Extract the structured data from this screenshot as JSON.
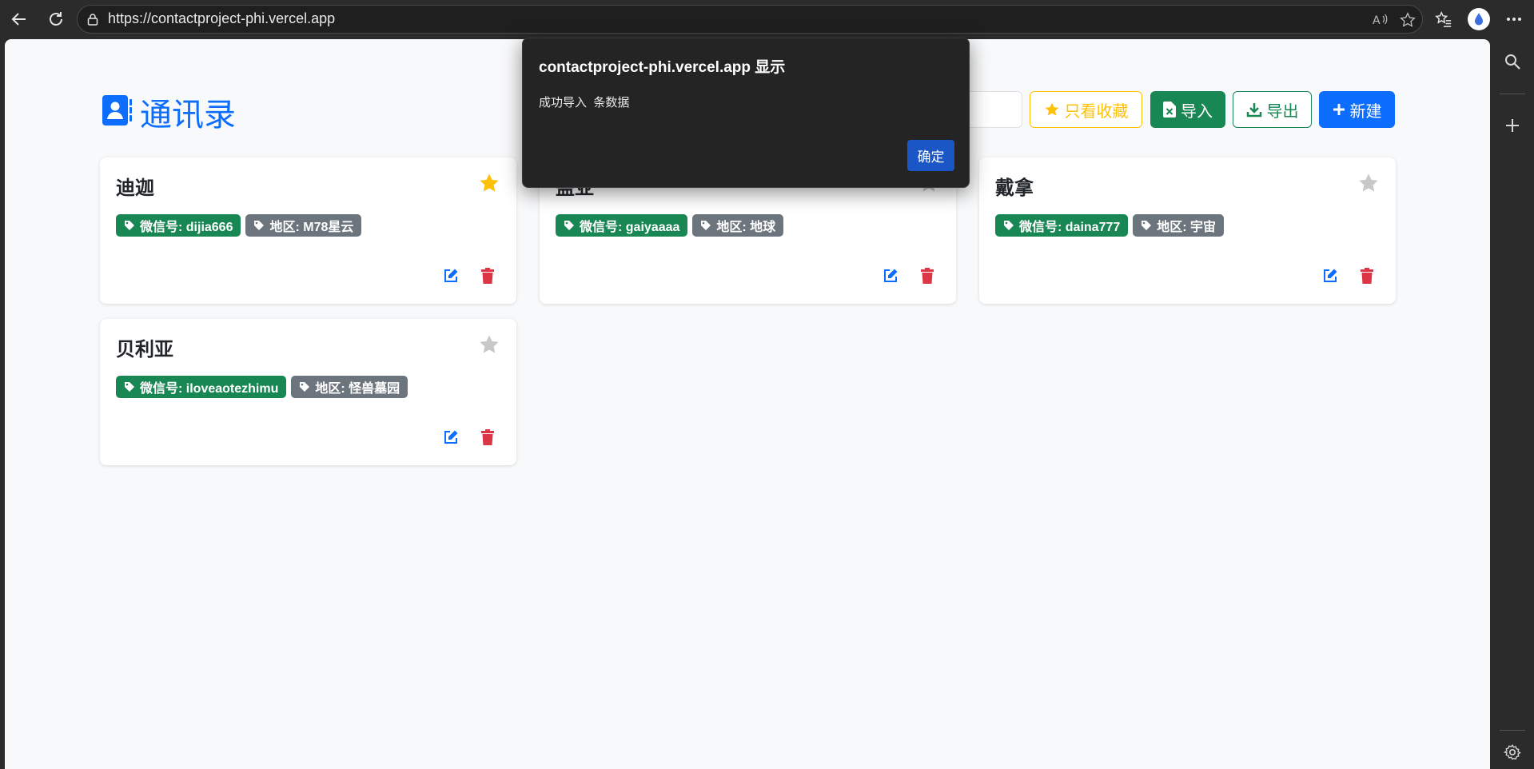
{
  "browser": {
    "url": "https://contactproject-phi.vercel.app"
  },
  "app": {
    "title": "通讯录",
    "search_placeholder": "",
    "buttons": {
      "favorites": "只看收藏",
      "import": "导入",
      "export": "导出",
      "new": "新建"
    }
  },
  "contacts": [
    {
      "name": "迪迦",
      "wechat": "微信号: dijia666",
      "region": "地区: M78星云",
      "favorite": true
    },
    {
      "name": "盖亚",
      "wechat": "微信号: gaiyaaaa",
      "region": "地区: 地球",
      "favorite": false
    },
    {
      "name": "戴拿",
      "wechat": "微信号: daina777",
      "region": "地区: 宇宙",
      "favorite": false
    },
    {
      "name": "贝利亚",
      "wechat": "微信号: iloveaotezhimu",
      "region": "地区: 怪兽墓园",
      "favorite": false
    }
  ],
  "dialog": {
    "title": "contactproject-phi.vercel.app 显示",
    "message": "成功导入  条数据",
    "ok": "确定"
  },
  "colors": {
    "primary": "#0d6efd",
    "success": "#198754",
    "warning": "#ffc107",
    "secondary": "#6c757d",
    "danger": "#dc3545",
    "star_inactive": "#c8c8c8"
  }
}
